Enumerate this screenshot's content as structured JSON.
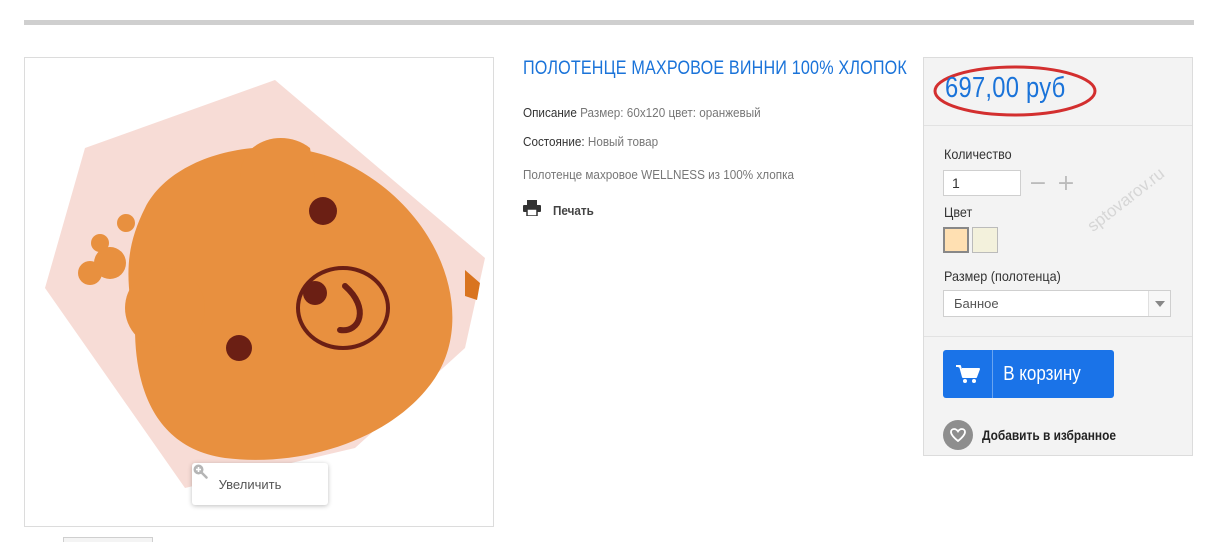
{
  "product": {
    "title": "ПОЛОТЕНЦЕ МАХРОВОЕ ВИННИ 100% ХЛОПОК",
    "description_label": "Описание",
    "description_value": " Размер: 60х120 цвет: оранжевый",
    "condition_label": "Состояние:",
    "condition_value": " Новый товар",
    "short_text": "Полотенце махровое WELLNESS из 100% хлопка",
    "print_label": "Печать",
    "zoom_label": "Увеличить"
  },
  "buy": {
    "price": "697,00 руб",
    "quantity_label": "Количество",
    "quantity_value": "1",
    "minus": "−",
    "plus": "+",
    "color_label": "Цвет",
    "colors": [
      "#ffe0b2",
      "#f3f1dc"
    ],
    "size_label": "Размер (полотенца)",
    "size_selected": "Банное",
    "cart_label": "В корзину",
    "wishlist_label": "Добавить в избранное"
  },
  "watermark": "sptovarov.ru",
  "colors": {
    "accent": "#1a73e8",
    "link": "#1a73d9",
    "highlight_ellipse": "#d32f2f",
    "towel_orange": "#e8903f",
    "towel_pink": "#f7dcd6"
  },
  "icons": {
    "print": "printer-icon",
    "zoom": "zoom-in-icon",
    "cart": "cart-icon",
    "wishlist": "heart-icon",
    "select": "chevron-down-icon"
  }
}
